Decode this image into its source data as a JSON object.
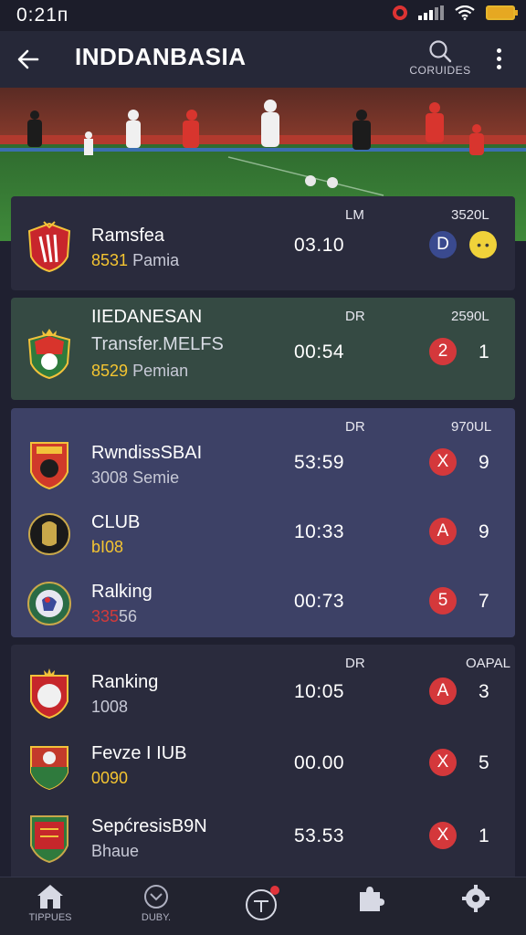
{
  "status_bar": {
    "time": "0:21п"
  },
  "app_bar": {
    "title": "INDDANBASIA",
    "search_label": "CORUIDES"
  },
  "cards": [
    {
      "col_mid": "LM",
      "col_right": "3520L",
      "rows": [
        {
          "name": "Ramsfea",
          "sub_num": "8531",
          "sub_label": "Pamia",
          "time": "03.10",
          "badge": "D",
          "score": "",
          "crest": "#c8262c"
        }
      ]
    },
    {
      "col_mid": "DR",
      "col_right": "2590L",
      "rows": [
        {
          "name": "IIEDANESAN",
          "line2": "Transfer.MELFS",
          "sub_num": "8529",
          "sub_label": "Pemian",
          "time": "00:54",
          "badge": "2",
          "score": "1",
          "crest": "#d8342c"
        }
      ]
    },
    {
      "col_mid": "DR",
      "col_right": "970UL",
      "rows": [
        {
          "name": "RwndissSBAI",
          "sub_num": "3008",
          "sub_label": "Semie",
          "time": "53:59",
          "badge": "X",
          "score": "9",
          "crest": "#d03a2a"
        },
        {
          "name": "CLUB",
          "sub_num": "bI08",
          "sub_label": "",
          "time": "10:33",
          "badge": "A",
          "score": "9",
          "crest": "#1a1a1a"
        },
        {
          "name": "Ralking",
          "sub_num": "335",
          "sub_label": "56",
          "time": "00:73",
          "badge": "5",
          "score": "7",
          "crest": "#2a6b45"
        }
      ]
    },
    {
      "col_mid": "DR",
      "col_right": "OAPAL",
      "rows": [
        {
          "name": "Ranking",
          "sub_num": "",
          "sub_label": "1008",
          "time": "10:05",
          "badge": "A",
          "score": "3",
          "crest": "#c6272b"
        },
        {
          "name": "Fevze I IUB",
          "sub_num": "0090",
          "sub_label": "",
          "time": "00.00",
          "badge": "X",
          "score": "5",
          "crest": "#c33a2b"
        },
        {
          "name": "SepćresisB9N",
          "sub_num": "",
          "sub_label": "Bhaue",
          "time": "53.53",
          "badge": "X",
          "score": "1",
          "crest": "#2f7a3d"
        }
      ]
    }
  ],
  "bottom_nav": [
    {
      "label": "TIPPUES",
      "icon": "home-icon"
    },
    {
      "label": "DUBY.",
      "icon": "chevron-circle-icon"
    },
    {
      "label": "",
      "icon": "tee-circle-icon"
    },
    {
      "label": "",
      "icon": "puzzle-icon"
    },
    {
      "label": "",
      "icon": "settings-icon"
    }
  ]
}
